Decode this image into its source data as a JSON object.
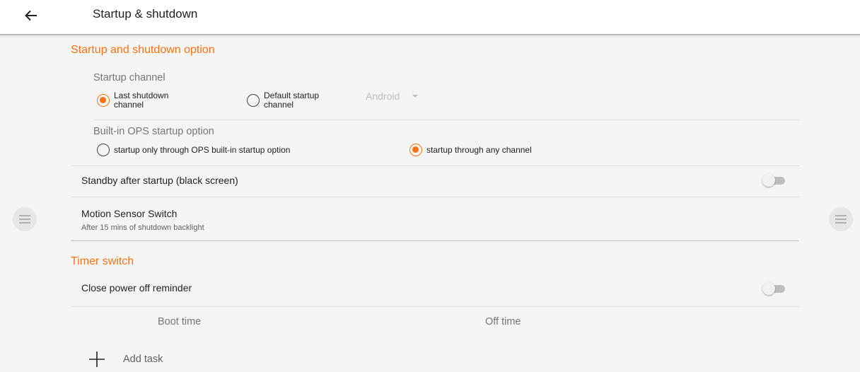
{
  "appbar": {
    "title": "Startup & shutdown",
    "back_icon": "arrow-left-icon"
  },
  "startup_shutdown": {
    "section_title": "Startup and shutdown option",
    "startup_channel": {
      "label": "Startup channel",
      "options": [
        {
          "label_line1": "Last shutdown",
          "label_line2": "channel",
          "checked": true
        },
        {
          "label_line1": "Default startup",
          "label_line2": "channel",
          "checked": false
        }
      ],
      "dropdown_value": "Android"
    },
    "ops_option": {
      "label": "Built-in OPS startup option",
      "options": [
        {
          "label": "startup only through OPS built-in startup option",
          "checked": false
        },
        {
          "label": "startup through any channel",
          "checked": true
        }
      ]
    },
    "standby": {
      "label": "Standby after startup (black screen)",
      "enabled": false
    },
    "motion_sensor": {
      "label": "Motion Sensor Switch",
      "subtitle": "After 15 mins of shutdown backlight"
    }
  },
  "timer": {
    "section_title": "Timer switch",
    "close_reminder": {
      "label": "Close power off reminder",
      "enabled": false
    },
    "columns": [
      "Boot time",
      "Off time"
    ],
    "add_task_label": "Add task"
  },
  "colors": {
    "accent": "#ff7214",
    "background": "#f5f5f5",
    "appbar": "#ffffff"
  }
}
